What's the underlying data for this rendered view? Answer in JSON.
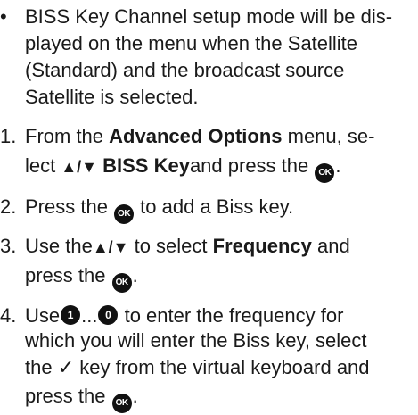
{
  "intro": {
    "bullet": "•",
    "l1": "BISS Key Channel setup mode will be dis-",
    "l2": "played on the menu when the Satellite",
    "l3": "(Standard) and the broadcast source",
    "l4": "Satellite is selected."
  },
  "step1": {
    "num": "1.",
    "a": "From the ",
    "b": "Advanced Options",
    "c": " menu, se-",
    "d": "lect ",
    "arrows": "▲/▼",
    "e": " BISS Key",
    "f": "and press the ",
    "g": "."
  },
  "step2": {
    "num": "2.",
    "a": "Press the ",
    "b": " to add a Biss key."
  },
  "step3": {
    "num": "3.",
    "a": "Use the",
    "arrows": "▲/▼",
    "b": " to select ",
    "c": "Frequency",
    "d": " and",
    "e": "press the ",
    "f": "."
  },
  "step4": {
    "num": "4.",
    "a": "Use",
    "n1": "1",
    "dots": "...",
    "n0": "0",
    "b": " to enter the frequency for",
    "c": "which you will enter the Biss key, select",
    "d": "the ",
    "check": "✓",
    "e": " key from the virtual keyboard and",
    "f": "press the ",
    "g": "."
  },
  "ok_label": "OK",
  "icons": {
    "ok": "ok-button-icon",
    "arrows": "up-down-arrows-icon",
    "check": "checkmark-icon"
  },
  "colors": {
    "text": "#1a1a1a",
    "button": "#111111"
  }
}
